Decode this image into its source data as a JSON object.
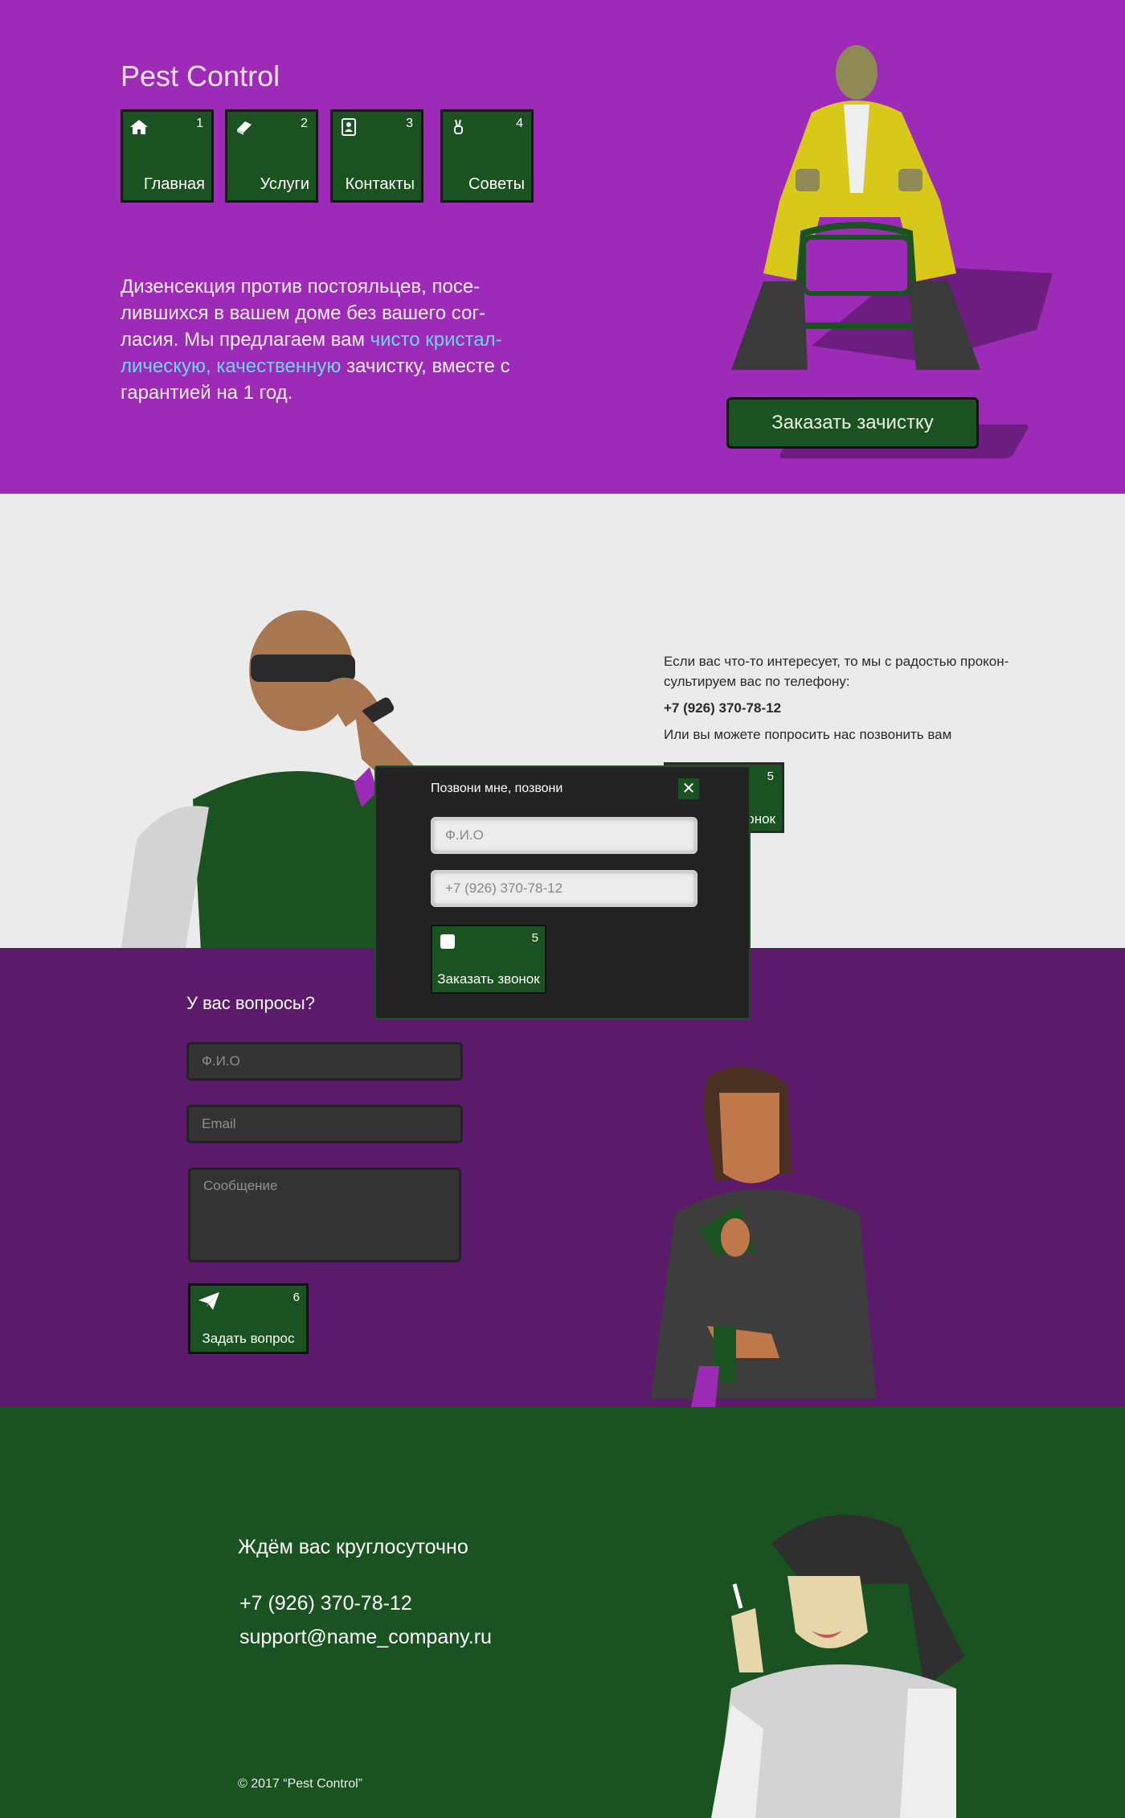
{
  "hero": {
    "logo": "Pest Control",
    "nav": [
      {
        "num": "1",
        "label": "Главная",
        "icon": "home-icon"
      },
      {
        "num": "2",
        "label": "Услуги",
        "icon": "book-icon"
      },
      {
        "num": "3",
        "label": "Контакты",
        "icon": "contacts-icon"
      },
      {
        "num": "4",
        "label": "Советы",
        "icon": "victory-hand-icon"
      }
    ],
    "text_before": "Дизенсекция против постояльцев, посе-лившихся в вашем доме без вашего сог-ласия. Мы предлагаем вам ",
    "text_highlight": "чисто кристал-лическую, качественную",
    "text_after": "  зачистку, вместе с гарантией на 1 год.",
    "cta": "Заказать зачистку"
  },
  "call": {
    "text1": "Если вас что-то интересует, то мы с радостью прокон-сультируем вас по телефону:",
    "phone": "+7 (926) 370-78-12",
    "text2": "Или вы можете попросить нас позвонить вам",
    "button_num": "5",
    "button_label_partial": "онок"
  },
  "modal": {
    "title": "Позвони мне, позвони",
    "close": "✕",
    "name_placeholder": "Ф.И.О",
    "phone_placeholder": "+7 (926) 370-78-12",
    "button_num": "5",
    "button_label": "Заказать звонок"
  },
  "ask": {
    "title": "У вас вопросы?",
    "name_placeholder": "Ф.И.О",
    "email_placeholder": "Email",
    "message_placeholder": "Сообщение",
    "button_num": "6",
    "button_label": "Задать вопрос"
  },
  "footer": {
    "title": "Ждём вас круглосуточно",
    "phone": "+7 (926) 370-78-12",
    "email": "support@name_company.ru",
    "copyright": "© 2017 “Pest Control”"
  },
  "colors": {
    "purple": "#9e2bb7",
    "dark_purple": "#5b1a6a",
    "green": "#1b5221",
    "light": "#ebebeb",
    "link": "#6fd3f5"
  }
}
